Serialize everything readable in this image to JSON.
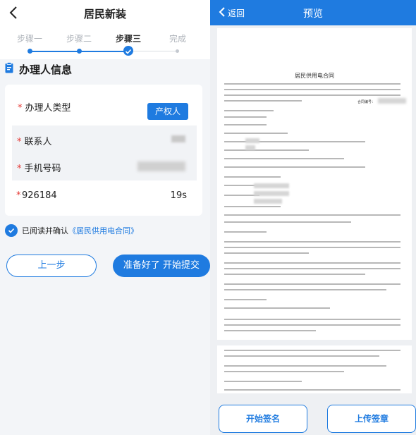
{
  "left": {
    "title": "居民新装",
    "steps": [
      "步骤一",
      "步骤二",
      "步骤三",
      "完成"
    ],
    "active_step": 3,
    "section_title": "办理人信息",
    "fields": {
      "handler_type_label": "办理人类型",
      "handler_type_value": "产权人",
      "contact_label": "联系人",
      "phone_label": "手机号码",
      "code_value": "926184",
      "code_timer": "19s"
    },
    "agree_text": "已阅读并确认",
    "agree_link": "《居民供用电合同》",
    "prev_button": "上一步",
    "submit_button": "准备好了 开始提交"
  },
  "right": {
    "back_label": "返回",
    "title": "预览",
    "doc_title": "居民供用电合同",
    "doc_no_label": "合同编号：",
    "sign_button": "开始签名",
    "upload_button": "上传签章"
  },
  "colors": {
    "accent": "#1f7be0",
    "required": "#e53935"
  },
  "icons": {
    "back": "chevron-left-icon",
    "section": "clipboard-icon",
    "check": "check-circle-icon"
  }
}
